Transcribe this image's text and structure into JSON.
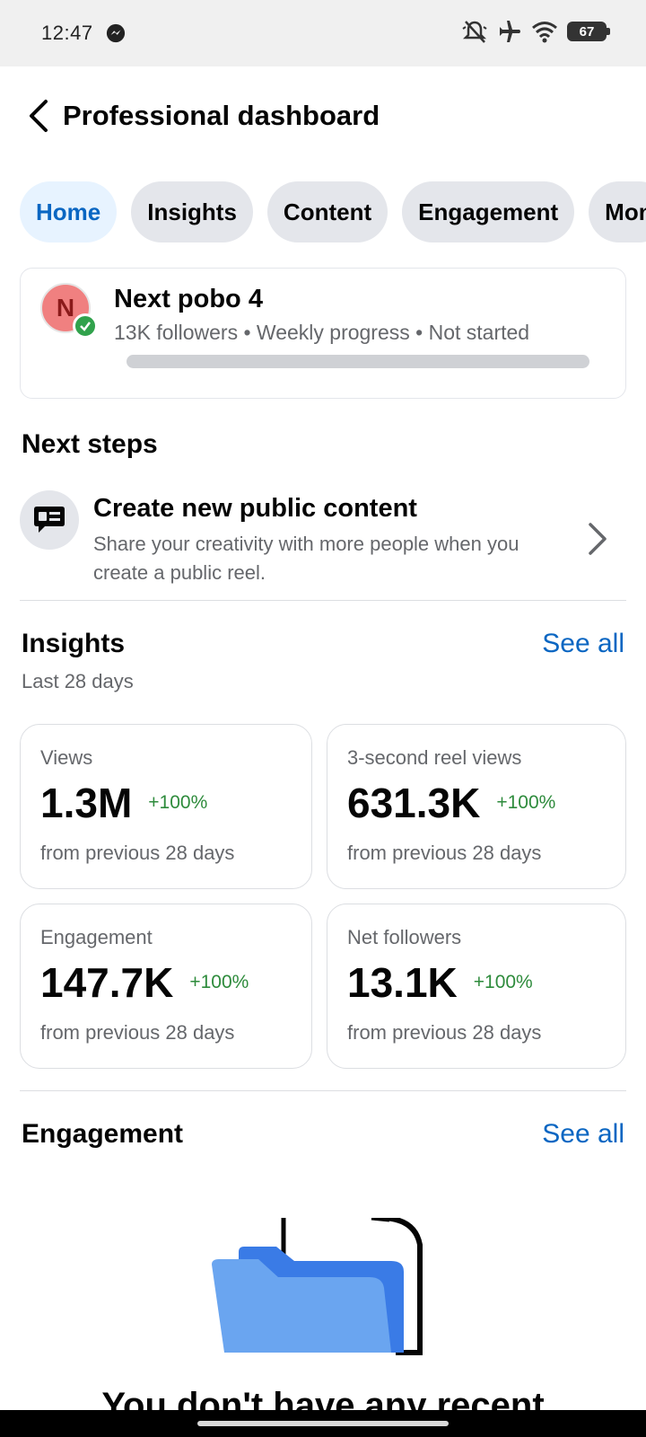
{
  "status_bar": {
    "time": "12:47",
    "battery": "67",
    "icons": [
      "messenger-icon",
      "mute-icon",
      "airplane-icon",
      "wifi-icon",
      "battery-icon"
    ]
  },
  "header": {
    "title": "Professional dashboard",
    "back_icon": "back-arrow-icon"
  },
  "tabs": [
    {
      "label": "Home",
      "active": true
    },
    {
      "label": "Insights",
      "active": false
    },
    {
      "label": "Content",
      "active": false
    },
    {
      "label": "Engagement",
      "active": false
    },
    {
      "label": "Mon",
      "active": false
    }
  ],
  "profile": {
    "avatar_letter": "N",
    "name": "Next pobo 4",
    "meta": "13K followers • Weekly progress • Not started",
    "progress": 0
  },
  "next_steps": {
    "heading": "Next steps",
    "items": [
      {
        "title": "Create new public content",
        "description": "Share your creativity with more people when you create a public reel.",
        "icon": "content-chat-icon"
      }
    ]
  },
  "insights": {
    "heading": "Insights",
    "see_all": "See all",
    "period": "Last 28 days",
    "metrics": [
      {
        "label": "Views",
        "value": "1.3M",
        "change": "+100%",
        "foot": "from previous 28 days"
      },
      {
        "label": "3-second reel views",
        "value": "631.3K",
        "change": "+100%",
        "foot": "from previous 28 days"
      },
      {
        "label": "Engagement",
        "value": "147.7K",
        "change": "+100%",
        "foot": "from previous 28 days"
      },
      {
        "label": "Net followers",
        "value": "13.1K",
        "change": "+100%",
        "foot": "from previous 28 days"
      }
    ]
  },
  "engagement": {
    "heading": "Engagement",
    "see_all": "See all",
    "empty_text": "You don't have any recent"
  },
  "colors": {
    "accent": "#0a66c2",
    "positive": "#2e8b3c",
    "secondary_text": "#65676b"
  }
}
